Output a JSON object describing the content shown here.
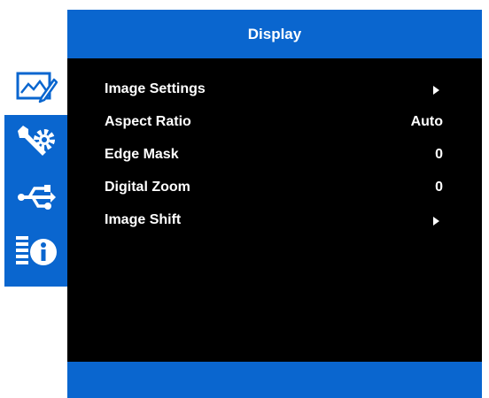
{
  "header": {
    "title": "Display"
  },
  "tabs": [
    {
      "name": "display",
      "icon": "display-image-pencil-icon",
      "active": true
    },
    {
      "name": "setup",
      "icon": "wrench-gear-icon",
      "active": false
    },
    {
      "name": "connectivity",
      "icon": "usb-icon",
      "active": false
    },
    {
      "name": "information",
      "icon": "info-icon",
      "active": false
    }
  ],
  "menu": {
    "items": [
      {
        "label": "Image Settings",
        "value": "",
        "submenu": true
      },
      {
        "label": "Aspect Ratio",
        "value": "Auto",
        "submenu": false
      },
      {
        "label": "Edge Mask",
        "value": "0",
        "submenu": false
      },
      {
        "label": "Digital Zoom",
        "value": "0",
        "submenu": false
      },
      {
        "label": "Image Shift",
        "value": "",
        "submenu": true
      }
    ]
  },
  "colors": {
    "accent": "#0a66cf",
    "panel_background": "#000000",
    "text": "#ffffff"
  }
}
